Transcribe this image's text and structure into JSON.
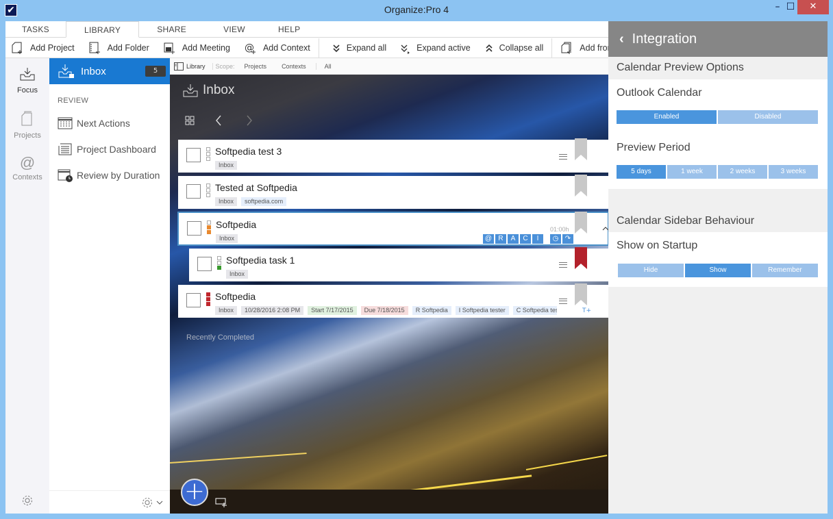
{
  "window": {
    "title": "Organize:Pro 4",
    "controls": {
      "minimize": "–",
      "maximize": "☐",
      "close": "✕"
    }
  },
  "ribbon": {
    "tabs": [
      {
        "label": "TASKS",
        "active": false
      },
      {
        "label": "LIBRARY",
        "active": true
      },
      {
        "label": "SHARE",
        "active": false
      },
      {
        "label": "VIEW",
        "active": false
      },
      {
        "label": "HELP",
        "active": false
      }
    ],
    "tools": [
      {
        "label": "Add Project",
        "icon": "add-project-icon"
      },
      {
        "label": "Add Folder",
        "icon": "add-folder-icon"
      },
      {
        "label": "Add Meeting",
        "icon": "add-meeting-icon"
      },
      {
        "label": "Add Context",
        "icon": "add-context-icon"
      },
      {
        "label": "Expand all",
        "icon": "expand-all-icon"
      },
      {
        "label": "Expand active",
        "icon": "expand-active-icon"
      },
      {
        "label": "Collapse all",
        "icon": "collapse-all-icon"
      },
      {
        "label": "Add from Te",
        "icon": "add-from-template-icon"
      }
    ]
  },
  "rail": {
    "items": [
      {
        "label": "Focus",
        "active": true
      },
      {
        "label": "Projects",
        "active": false
      },
      {
        "label": "Contexts",
        "active": false
      }
    ]
  },
  "sidebar": {
    "inbox": {
      "label": "Inbox",
      "count": "5"
    },
    "review_heading": "REVIEW",
    "links": [
      {
        "label": "Next Actions"
      },
      {
        "label": "Project Dashboard"
      },
      {
        "label": "Review by Duration"
      }
    ]
  },
  "libbar": {
    "library": "Library",
    "scope": "Scope:",
    "projects": "Projects",
    "contexts": "Contexts",
    "all": "All"
  },
  "main": {
    "title": "Inbox",
    "recently_completed": "Recently Completed",
    "tasks": [
      {
        "title": "Softpedia test 3",
        "tags": [
          {
            "text": "Inbox",
            "kind": "grey"
          }
        ],
        "priority": "none"
      },
      {
        "title": "Tested at Softpedia",
        "tags": [
          {
            "text": "Inbox",
            "kind": "grey"
          },
          {
            "text": "softpedia.com",
            "kind": "blue"
          }
        ],
        "priority": "none"
      },
      {
        "title": "Softpedia",
        "tags": [
          {
            "text": "Inbox",
            "kind": "grey"
          }
        ],
        "priority": "medium",
        "duration": "01:00h",
        "raci": [
          "@",
          "R",
          "A",
          "C",
          "I"
        ]
      },
      {
        "title": "Softpedia task 1",
        "tags": [
          {
            "text": "Inbox",
            "kind": "grey"
          }
        ],
        "priority": "low"
      },
      {
        "title": "Softpedia",
        "tags": [
          {
            "text": "Inbox",
            "kind": "grey"
          },
          {
            "text": "10/28/2016 2:08 PM",
            "kind": "grey"
          },
          {
            "text": "Start 7/17/2015",
            "kind": "green"
          },
          {
            "text": "Due 7/18/2015",
            "kind": "red"
          },
          {
            "text": "R  Softpedia",
            "kind": "blue"
          },
          {
            "text": "I  Softpedia tester",
            "kind": "blue"
          },
          {
            "text": "C  Softpedia test",
            "kind": "blue"
          }
        ],
        "priority": "high"
      }
    ],
    "fab": "+"
  },
  "panel": {
    "title": "Integration",
    "section1": "Calendar Preview Options",
    "outlook_label": "Outlook Calendar",
    "outlook_options": [
      {
        "label": "Enabled",
        "selected": true
      },
      {
        "label": "Disabled",
        "selected": false
      }
    ],
    "period_label": "Preview Period",
    "period_options": [
      {
        "label": "5 days",
        "selected": true
      },
      {
        "label": "1 week",
        "selected": false
      },
      {
        "label": "2 weeks",
        "selected": false
      },
      {
        "label": "3 weeks",
        "selected": false
      }
    ],
    "section2": "Calendar Sidebar Behaviour",
    "startup_label": "Show on Startup",
    "startup_options": [
      {
        "label": "Hide",
        "selected": false
      },
      {
        "label": "Show",
        "selected": true
      },
      {
        "label": "Remember",
        "selected": false
      }
    ]
  },
  "colors": {
    "accent": "#1979d2",
    "seg_on": "#4a95dd",
    "seg_off": "#9bc1ea",
    "prio_medium": "#e8892f",
    "prio_low": "#3a9a2e",
    "prio_high": "#c0272d"
  }
}
